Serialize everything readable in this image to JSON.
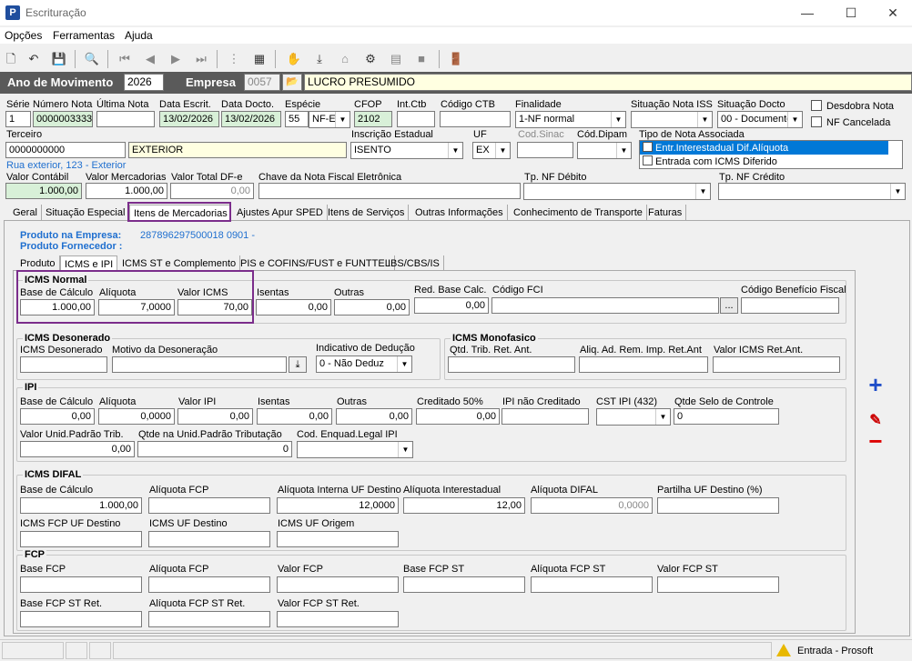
{
  "window": {
    "title": "Escrituração"
  },
  "menu": [
    "Opções",
    "Ferramentas",
    "Ajuda"
  ],
  "header": {
    "ano_label": "Ano de Movimento",
    "ano": "2026",
    "empresa_label": "Empresa",
    "empresa_code": "0057",
    "empresa_nome": "LUCRO PRESUMIDO"
  },
  "nota": {
    "serie_label": "Série",
    "serie": "1",
    "numero_label": "Número Nota",
    "numero": "0000003333",
    "ultima_label": "Última Nota",
    "ultima": "",
    "data_escrit_label": "Data Escrit.",
    "data_escrit": "13/02/2026",
    "data_docto_label": "Data Docto.",
    "data_docto": "13/02/2026",
    "especie_label": "Espécie",
    "especie_code": "55",
    "especie": "NF-E",
    "cfop_label": "CFOP",
    "cfop": "2102",
    "intctb_label": "Int.Ctb",
    "codctb_label": "Código CTB",
    "finalidade_label": "Finalidade",
    "finalidade": "1-NF normal",
    "situacao_iss_label": "Situação Nota ISS",
    "situacao_docto_label": "Situação Docto",
    "situacao_docto": "00 - Documento regular",
    "desdobra_label": "Desdobra Nota",
    "nf_cancelada_label": "NF Cancelada",
    "terceiro_label": "Terceiro",
    "terceiro_code": "0000000000",
    "terceiro_nome": "EXTERIOR",
    "terceiro_endereco": "Rua exterior, 123 - Exterior",
    "ie_label": "Inscrição Estadual",
    "ie": "ISENTO",
    "uf_label": "UF",
    "uf": "EX",
    "cod_sinac_label": "Cod.Sinac",
    "cod_dipam_label": "Cód.Dipam",
    "tipo_nota_label": "Tipo de Nota Associada",
    "tipo_nota_items": [
      "Entr.Interestadual Dif.Alíquota",
      "Entrada com ICMS Diferido"
    ],
    "valor_contabil_label": "Valor Contábil",
    "valor_contabil": "1.000,00",
    "valor_merc_label": "Valor Mercadorias",
    "valor_merc": "1.000,00",
    "valor_dfe_label": "Valor Total DF-e",
    "valor_dfe": "0,00",
    "chave_label": "Chave da Nota Fiscal Eletrônica",
    "tp_debito_label": "Tp. NF Débito",
    "tp_credito_label": "Tp. NF Crédito"
  },
  "tabs": [
    "Geral",
    "Situação Especial",
    "Itens de Mercadorias",
    "Ajustes Apur SPED",
    "Itens de Serviços",
    "Outras Informações",
    "Conhecimento de Transporte",
    "Faturas"
  ],
  "produto": {
    "empresa_label": "Produto na Empresa:",
    "empresa_val": "287896297500018 0901 -",
    "fornecedor_label": "Produto Fornecedor :"
  },
  "subtabs": [
    "Produto",
    "ICMS e IPI",
    "ICMS ST e Complemento",
    "PIS e COFINS/FUST e FUNTTEL",
    "IBS/CBS/IS"
  ],
  "icms_normal": {
    "title": "ICMS Normal",
    "base_label": "Base de Cálculo",
    "base": "1.000,00",
    "aliq_label": "Alíquota",
    "aliq": "7,0000",
    "valor_label": "Valor ICMS",
    "valor": "70,00",
    "isentas_label": "Isentas",
    "isentas": "0,00",
    "outras_label": "Outras",
    "outras": "0,00",
    "red_label": "Red. Base Calc.",
    "red": "0,00",
    "fci_label": "Código FCI",
    "beneficio_label": "Código Benefício Fiscal",
    "ellipsis": "..."
  },
  "icms_deson": {
    "title": "ICMS Desonerado",
    "icms_label": "ICMS Desonerado",
    "motivo_label": "Motivo da Desoneração",
    "indicativo_label": "Indicativo de Dedução",
    "indicativo": "0 - Não Deduz"
  },
  "icms_mono": {
    "title": "ICMS Monofasico",
    "qtd_label": "Qtd. Trib. Ret. Ant.",
    "aliq_label": "Aliq. Ad. Rem. Imp. Ret.Ant",
    "valor_label": "Valor ICMS Ret.Ant."
  },
  "ipi": {
    "title": "IPI",
    "base_label": "Base de Cálculo",
    "base": "0,00",
    "aliq_label": "Alíquota",
    "aliq": "0,0000",
    "valor_label": "Valor IPI",
    "valor": "0,00",
    "isentas_label": "Isentas",
    "isentas": "0,00",
    "outras_label": "Outras",
    "outras": "0,00",
    "cred_label": "Creditado 50%",
    "cred": "0,00",
    "nao_cred_label": "IPI não Creditado",
    "cst_label": "CST IPI (432)",
    "selo_label": "Qtde Selo de Controle",
    "selo": "0",
    "unid_label": "Valor Unid.Padrão Trib.",
    "unid": "0,00",
    "qtd_label": "Qtde na Unid.Padrão Tributação",
    "qtd": "0",
    "enquad_label": "Cod. Enquad.Legal IPI"
  },
  "difal": {
    "title": "ICMS DIFAL",
    "base_label": "Base de Cálculo",
    "base": "1.000,00",
    "aliq_fcp_label": "Alíquota FCP",
    "aliq_int_dest_label": "Alíquota Interna UF Destino",
    "aliq_int_dest": "12,0000",
    "aliq_inter_label": "Alíquota Interestadual",
    "aliq_inter": "12,00",
    "aliq_difal_label": "Alíquota DIFAL",
    "aliq_difal": "0,0000",
    "partilha_label": "Partilha UF Destino (%)",
    "fcp_uf_dest_label": "ICMS FCP UF Destino",
    "icms_uf_dest_label": "ICMS UF Destino",
    "icms_uf_orig_label": "ICMS UF Origem"
  },
  "fcp": {
    "title": "FCP",
    "base_label": "Base FCP",
    "aliq_label": "Alíquota FCP",
    "valor_label": "Valor FCP",
    "base_st_label": "Base FCP ST",
    "aliq_st_label": "Alíquota FCP ST",
    "valor_st_label": "Valor FCP ST",
    "base_st_ret_label": "Base FCP ST Ret.",
    "aliq_st_ret_label": "Alíquota FCP ST Ret.",
    "valor_st_ret_label": "Valor FCP ST Ret."
  },
  "side": {
    "add": "+",
    "minus": "−"
  },
  "status": {
    "text": "Entrada - Prosoft"
  }
}
